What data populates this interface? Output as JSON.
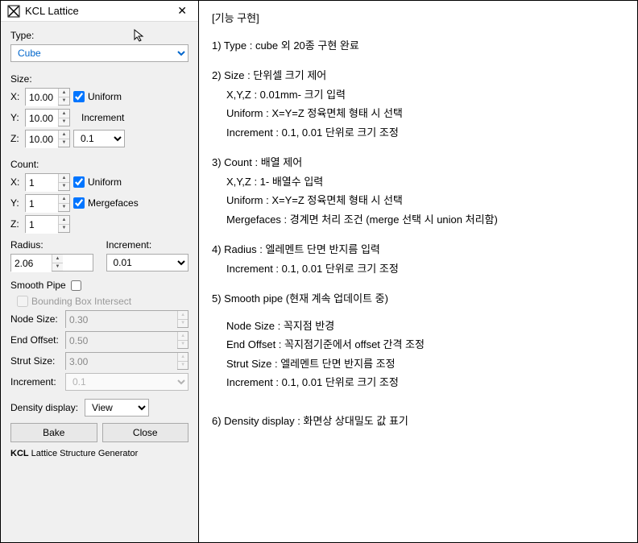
{
  "window": {
    "title": "KCL Lattice",
    "close": "✕"
  },
  "panel": {
    "type_label": "Type:",
    "type_value": "Cube",
    "size_label": "Size:",
    "size": {
      "x_label": "X:",
      "x_value": "10.00",
      "y_label": "Y:",
      "y_value": "10.00",
      "z_label": "Z:",
      "z_value": "10.00",
      "uniform_label": "Uniform",
      "uniform_checked": true,
      "increment_label": "Increment",
      "increment_value": "0.1"
    },
    "count_label": "Count:",
    "count": {
      "x_label": "X:",
      "x_value": "1",
      "y_label": "Y:",
      "y_value": "1",
      "z_label": "Z:",
      "z_value": "1",
      "uniform_label": "Uniform",
      "uniform_checked": true,
      "mergefaces_label": "Mergefaces",
      "mergefaces_checked": true
    },
    "radius_label": "Radius:",
    "radius_value": "2.06",
    "radius_increment_label": "Increment:",
    "radius_increment_value": "0.01",
    "smooth_pipe_label": "Smooth Pipe",
    "smooth_pipe_checked": false,
    "bbox_label": "Bounding Box Intersect",
    "bbox_checked": false,
    "node_size_label": "Node Size:",
    "node_size_value": "0.30",
    "end_offset_label": "End Offset:",
    "end_offset_value": "0.50",
    "strut_size_label": "Strut Size:",
    "strut_size_value": "3.00",
    "increment_label": "Increment:",
    "increment_value": "0.1",
    "density_label": "Density display:",
    "density_value": "View",
    "bake_label": "Bake",
    "close_label": "Close",
    "footer_bold": "KCL",
    "footer_text": " Lattice Structure Generator"
  },
  "doc": {
    "header": "[기능 구현]",
    "s1": "1) Type : cube 외 20종 구현 완료",
    "s2": "2) Size : 단위셀 크기 제어",
    "s2a": "X,Y,Z : 0.01mm- 크기 입력",
    "s2b": "Uniform : X=Y=Z 정육면체 형태 시 선택",
    "s2c": "Increment : 0.1, 0.01 단위로 크기 조정",
    "s3": "3) Count : 배열 제어",
    "s3a": "X,Y,Z : 1- 배열수 입력",
    "s3b": "Uniform : X=Y=Z 정육면체 형태 시 선택",
    "s3c": "Mergefaces : 경계면 처리 조건 (merge 선택 시 union 처리함)",
    "s4": "4) Radius : 엘레멘트 단면 반지름 입력",
    "s4a": "Increment : 0.1, 0.01 단위로 크기 조정",
    "s5": "5) Smooth pipe (현재 계속 업데이트 중)",
    "s5a": "Node Size : 꼭지점 반경",
    "s5b": "End Offset : 꼭지점기준에서 offset 간격 조정",
    "s5c": "Strut Size : 엘레멘트 단면 반지름 조정",
    "s5d": "Increment : 0.1, 0.01 단위로 크기 조정",
    "s6": "6) Density display : 화면상 상대밀도 값 표기"
  }
}
